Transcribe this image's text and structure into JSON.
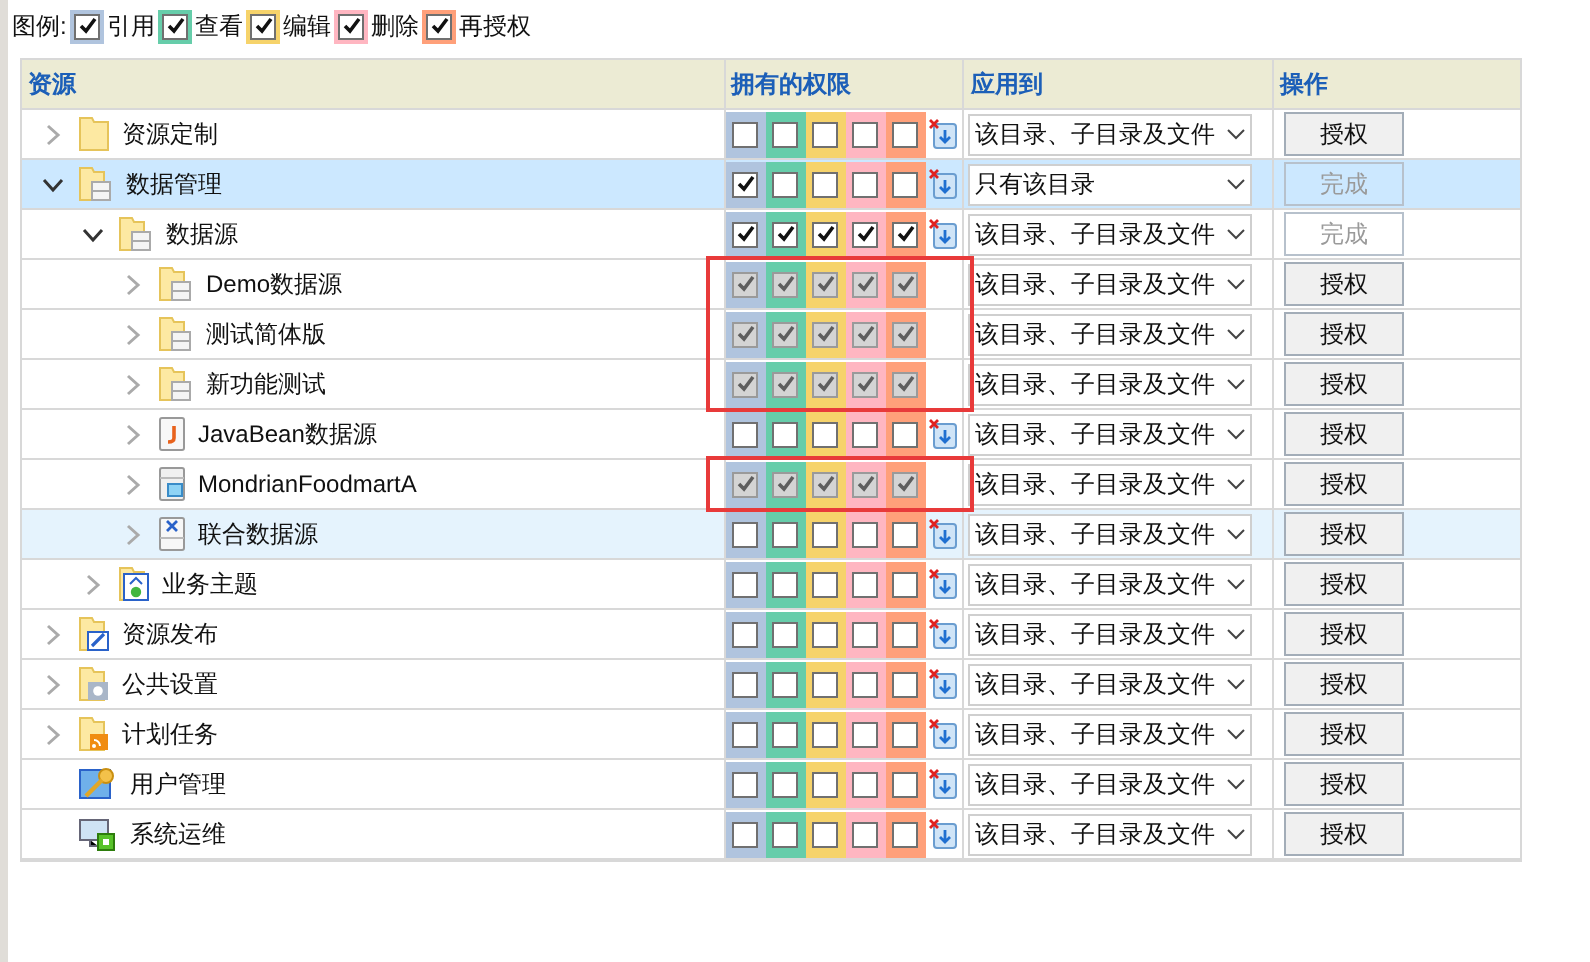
{
  "legend": {
    "label": "图例:",
    "items": [
      {
        "label": "引用",
        "color": "#b0c4de",
        "checked": true
      },
      {
        "label": "查看",
        "color": "#66cdaa",
        "checked": true
      },
      {
        "label": "编辑",
        "color": "#f6d36b",
        "checked": true
      },
      {
        "label": "删除",
        "color": "#ffb6c1",
        "checked": true
      },
      {
        "label": "再授权",
        "color": "#ffa07a",
        "checked": true
      }
    ]
  },
  "columns": [
    "资源",
    "拥有的权限",
    "应用到",
    "操作"
  ],
  "tree": [
    {
      "name": "资源定制",
      "kind": "folder",
      "expandable": true,
      "expanded": false,
      "selected": false,
      "hovered": false,
      "annotated": false,
      "inherited": false,
      "permissions": [
        false,
        false,
        false,
        false,
        false
      ],
      "apply_to": "该目录、子目录及文件",
      "action": {
        "label": "授权",
        "disabled": false
      }
    },
    {
      "name": "数据管理",
      "kind": "folder-db",
      "expandable": true,
      "expanded": true,
      "selected": true,
      "hovered": false,
      "annotated": false,
      "inherited": false,
      "permissions": [
        true,
        false,
        false,
        false,
        false
      ],
      "apply_to": "只有该目录",
      "action": {
        "label": "完成",
        "disabled": true
      },
      "children": [
        {
          "name": "数据源",
          "kind": "folder-db",
          "expandable": true,
          "expanded": true,
          "selected": false,
          "hovered": false,
          "annotated": false,
          "inherited": false,
          "permissions": [
            true,
            true,
            true,
            true,
            true
          ],
          "apply_to": "该目录、子目录及文件",
          "action": {
            "label": "完成",
            "disabled": true
          },
          "children": [
            {
              "name": "Demo数据源",
              "kind": "folder-db",
              "expandable": true,
              "expanded": false,
              "selected": false,
              "hovered": false,
              "annotated": true,
              "inherited": true,
              "permissions": [
                true,
                true,
                true,
                true,
                true
              ],
              "apply_to": "该目录、子目录及文件",
              "action": {
                "label": "授权",
                "disabled": false
              }
            },
            {
              "name": "测试简体版",
              "kind": "folder-db",
              "expandable": true,
              "expanded": false,
              "selected": false,
              "hovered": false,
              "annotated": true,
              "inherited": true,
              "permissions": [
                true,
                true,
                true,
                true,
                true
              ],
              "apply_to": "该目录、子目录及文件",
              "action": {
                "label": "授权",
                "disabled": false
              }
            },
            {
              "name": "新功能测试",
              "kind": "folder-db",
              "expandable": true,
              "expanded": false,
              "selected": false,
              "hovered": false,
              "annotated": true,
              "inherited": true,
              "permissions": [
                true,
                true,
                true,
                true,
                true
              ],
              "apply_to": "该目录、子目录及文件",
              "action": {
                "label": "授权",
                "disabled": false
              }
            },
            {
              "name": "JavaBean数据源",
              "kind": "java",
              "expandable": true,
              "expanded": false,
              "selected": false,
              "hovered": false,
              "annotated": false,
              "inherited": false,
              "permissions": [
                false,
                false,
                false,
                false,
                false
              ],
              "apply_to": "该目录、子目录及文件",
              "action": {
                "label": "授权",
                "disabled": false
              }
            },
            {
              "name": "MondrianFoodmartA",
              "kind": "cube",
              "expandable": true,
              "expanded": false,
              "selected": false,
              "hovered": false,
              "annotated": true,
              "inherited": true,
              "permissions": [
                true,
                true,
                true,
                true,
                true
              ],
              "apply_to": "该目录、子目录及文件",
              "action": {
                "label": "授权",
                "disabled": false
              }
            },
            {
              "name": "联合数据源",
              "kind": "union",
              "expandable": true,
              "expanded": false,
              "selected": false,
              "hovered": true,
              "annotated": false,
              "inherited": false,
              "permissions": [
                false,
                false,
                false,
                false,
                false
              ],
              "apply_to": "该目录、子目录及文件",
              "action": {
                "label": "授权",
                "disabled": false
              }
            }
          ]
        },
        {
          "name": "业务主题",
          "kind": "subject",
          "expandable": true,
          "expanded": false,
          "selected": false,
          "hovered": false,
          "annotated": false,
          "inherited": false,
          "permissions": [
            false,
            false,
            false,
            false,
            false
          ],
          "apply_to": "该目录、子目录及文件",
          "action": {
            "label": "授权",
            "disabled": false
          }
        }
      ]
    },
    {
      "name": "资源发布",
      "kind": "publish",
      "expandable": true,
      "expanded": false,
      "selected": false,
      "hovered": false,
      "annotated": false,
      "inherited": false,
      "permissions": [
        false,
        false,
        false,
        false,
        false
      ],
      "apply_to": "该目录、子目录及文件",
      "action": {
        "label": "授权",
        "disabled": false
      }
    },
    {
      "name": "公共设置",
      "kind": "gear",
      "expandable": true,
      "expanded": false,
      "selected": false,
      "hovered": false,
      "annotated": false,
      "inherited": false,
      "permissions": [
        false,
        false,
        false,
        false,
        false
      ],
      "apply_to": "该目录、子目录及文件",
      "action": {
        "label": "授权",
        "disabled": false
      }
    },
    {
      "name": "计划任务",
      "kind": "task",
      "expandable": true,
      "expanded": false,
      "selected": false,
      "hovered": false,
      "annotated": false,
      "inherited": false,
      "permissions": [
        false,
        false,
        false,
        false,
        false
      ],
      "apply_to": "该目录、子目录及文件",
      "action": {
        "label": "授权",
        "disabled": false
      }
    },
    {
      "name": "用户管理",
      "kind": "users",
      "expandable": false,
      "selected": false,
      "hovered": false,
      "annotated": false,
      "inherited": false,
      "permissions": [
        false,
        false,
        false,
        false,
        false
      ],
      "apply_to": "该目录、子目录及文件",
      "action": {
        "label": "授权",
        "disabled": false
      }
    },
    {
      "name": "系统运维",
      "kind": "monitor",
      "expandable": false,
      "selected": false,
      "hovered": false,
      "annotated": false,
      "inherited": false,
      "permissions": [
        false,
        false,
        false,
        false,
        false
      ],
      "apply_to": "该目录、子目录及文件",
      "action": {
        "label": "授权",
        "disabled": false
      }
    }
  ]
}
